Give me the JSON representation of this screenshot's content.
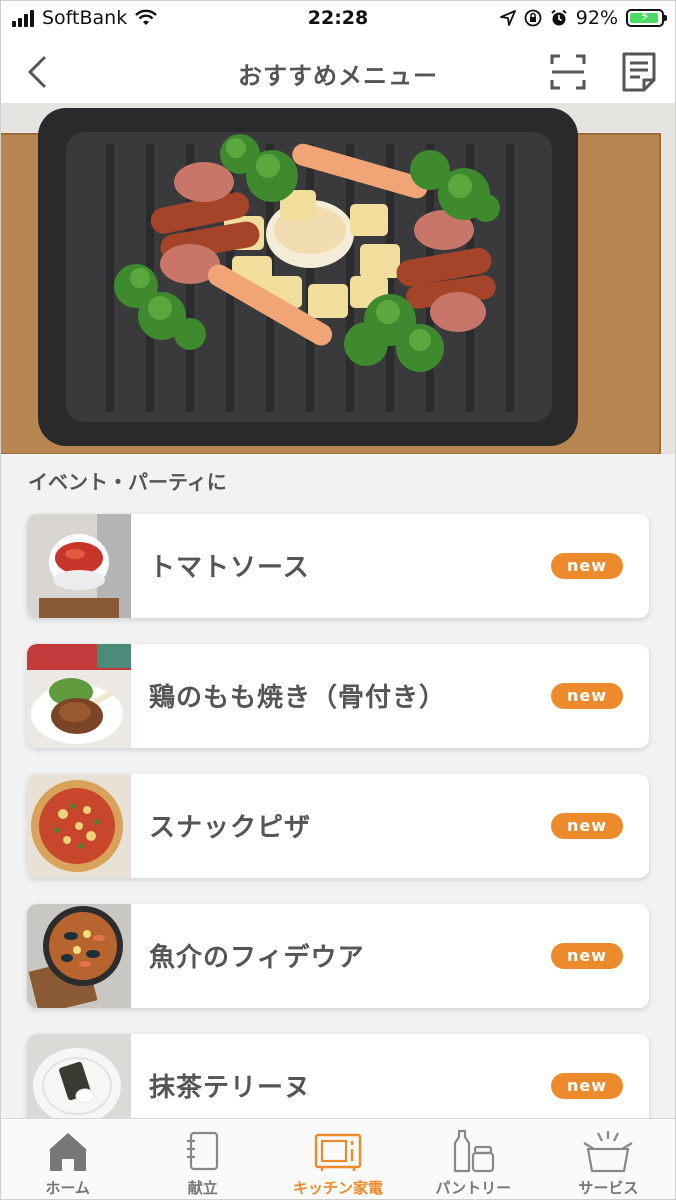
{
  "status_bar": {
    "carrier": "SoftBank",
    "time": "22:28",
    "battery_percent": "92%",
    "battery_level": 0.92
  },
  "header": {
    "title": "おすすめメニュー",
    "icons": [
      "back-chevron-icon",
      "scan-icon",
      "memo-icon"
    ]
  },
  "hero": {
    "icon": "grilled-dish-photo"
  },
  "section": {
    "title": "イベント・パーティに"
  },
  "menu_items": [
    {
      "name": "トマトソース",
      "badge": "new"
    },
    {
      "name": "鶏のもも焼き（骨付き）",
      "badge": "new"
    },
    {
      "name": "スナックピザ",
      "badge": "new"
    },
    {
      "name": "魚介のフィデウア",
      "badge": "new"
    },
    {
      "name": "抹茶テリーヌ",
      "badge": "new"
    }
  ],
  "tabs": [
    {
      "label": "ホーム",
      "icon": "home-icon"
    },
    {
      "label": "献立",
      "icon": "notebook-icon"
    },
    {
      "label": "キッチン家電",
      "icon": "microwave-icon",
      "active": true
    },
    {
      "label": "パントリー",
      "icon": "pantry-icon"
    },
    {
      "label": "サービス",
      "icon": "service-box-icon"
    }
  ],
  "colors": {
    "accent": "#ec8a2c",
    "text": "#555555",
    "background": "#f2f2f2"
  }
}
